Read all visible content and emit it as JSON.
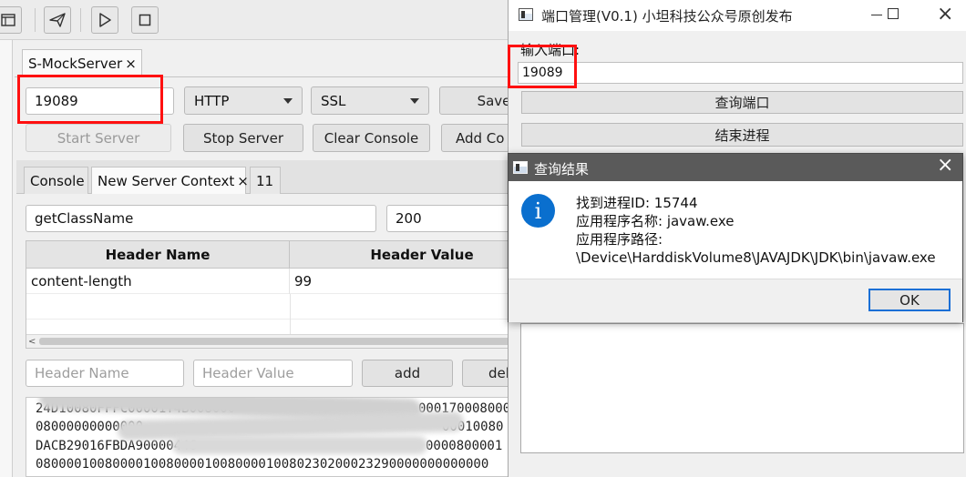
{
  "toolbar": {
    "icons": [
      "window-icon",
      "send-icon",
      "play-icon",
      "stop-icon"
    ]
  },
  "server_tab": {
    "label": "S-MockServer",
    "close": "×"
  },
  "port_input": {
    "value": "19089"
  },
  "protocol_select": {
    "value": "HTTP"
  },
  "ssl_select": {
    "value": "SSL"
  },
  "buttons": {
    "save": "Save",
    "start_server": "Start Server",
    "stop_server": "Stop Server",
    "clear_console": "Clear Console",
    "add_context": "Add Co",
    "add": "add",
    "delete": "del"
  },
  "context_tabs": [
    {
      "label": "Console"
    },
    {
      "label": "New Server Context",
      "close": "×"
    },
    {
      "label": "11"
    }
  ],
  "method_input": {
    "value": "getClassName"
  },
  "status_input": {
    "value": "200"
  },
  "headers_table": {
    "columns": [
      "Header Name",
      "Header Value"
    ],
    "rows": [
      {
        "name": "content-length",
        "value": "99"
      }
    ]
  },
  "header_name_input": {
    "placeholder": "Header Name"
  },
  "header_value_input": {
    "placeholder": "Header Value"
  },
  "hex_lines": [
    "24D10080FFFC00001T4B008000",
    "08000000000000",
    "DACB29016FBDA90000446",
    "08000010080000100800001008000010080230200023290000000000000"
  ],
  "hex_lines_right": [
    "000170008000",
    "00010080",
    "0000800001"
  ],
  "port_window": {
    "title": "端口管理(V0.1) 小坦科技公众号原创发布",
    "port_label": "输入端口:",
    "port_value": "19089",
    "query_button": "查询端口",
    "kill_button": "结束进程"
  },
  "dialog": {
    "title": "查询结果",
    "info_glyph": "i",
    "lines": [
      "找到进程ID: 15744",
      "应用程序名称: javaw.exe",
      "应用程序路径:",
      "\\Device\\HarddiskVolume8\\JAVAJDK\\JDK\\bin\\javaw.exe"
    ],
    "ok": "OK"
  },
  "colors": {
    "highlight_red": "#ff1010",
    "dialog_titlebar": "#5a5a5a",
    "info_blue": "#0a6fce",
    "ok_border": "#1a6fd6"
  }
}
